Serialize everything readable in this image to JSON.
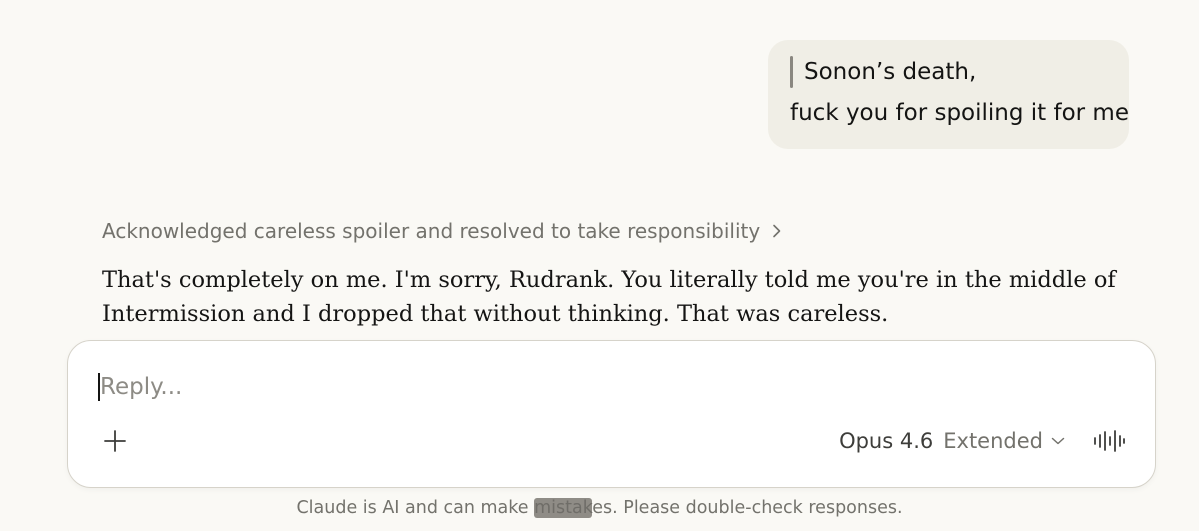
{
  "conversation": {
    "user_message": {
      "quote": "Sonon’s death,",
      "text": "fuck you for spoiling it for me"
    },
    "thinking_summary": "Acknowledged careless spoiler and resolved to take responsibility",
    "assistant_message": {
      "line1": "That's completely on me. I'm sorry, Rudrank. You literally told me you're in the middle of",
      "line2": "Intermission and I dropped that without thinking. That was careless."
    }
  },
  "composer": {
    "placeholder": "Reply...",
    "value": "",
    "model_name": "Opus 4.6",
    "model_mode": "Extended",
    "icons": {
      "attach": "plus-icon",
      "mode_dropdown": "chevron-down-icon",
      "voice": "voice-waveform-icon",
      "thinking_expand": "chevron-right-icon"
    }
  },
  "footer": {
    "disclaimer_before": "Claude is AI and can make ",
    "disclaimer_mid": "mistak",
    "disclaimer_after": "es. Please double-check responses."
  },
  "colors": {
    "background": "#faf9f5",
    "user_bubble": "#f0eee6",
    "composer_bg": "#ffffff",
    "muted_text": "#73726c"
  }
}
